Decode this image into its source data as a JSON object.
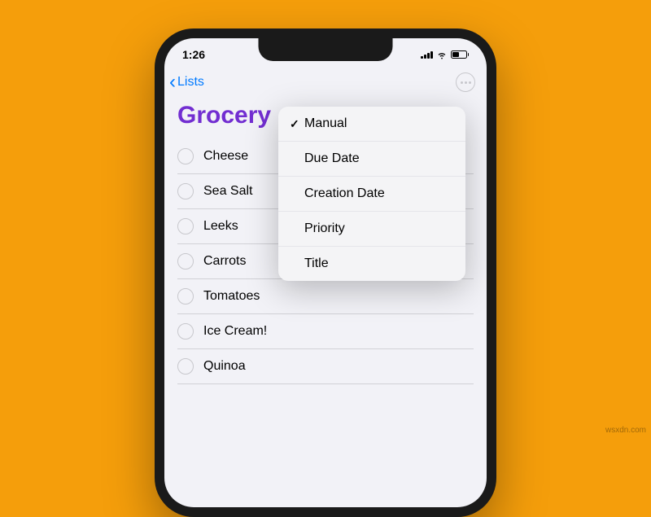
{
  "status": {
    "time": "1:26"
  },
  "nav": {
    "back_label": "Lists"
  },
  "list": {
    "title": "Grocery",
    "items": [
      {
        "label": "Cheese"
      },
      {
        "label": "Sea Salt"
      },
      {
        "label": "Leeks"
      },
      {
        "label": "Carrots"
      },
      {
        "label": "Tomatoes"
      },
      {
        "label": "Ice Cream!"
      },
      {
        "label": "Quinoa"
      }
    ]
  },
  "sort_menu": {
    "items": [
      {
        "label": "Manual",
        "selected": true
      },
      {
        "label": "Due Date",
        "selected": false
      },
      {
        "label": "Creation Date",
        "selected": false
      },
      {
        "label": "Priority",
        "selected": false
      },
      {
        "label": "Title",
        "selected": false
      }
    ]
  },
  "watermark": "wsxdn.com"
}
